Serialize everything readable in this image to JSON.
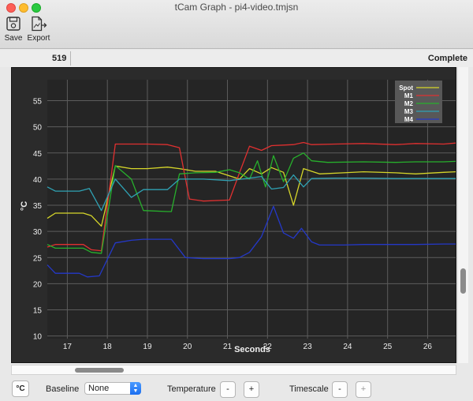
{
  "window": {
    "title": "tCam Graph - pi4-video.tmjsn"
  },
  "toolbar": {
    "save_label": "Save",
    "export_label": "Export"
  },
  "info": {
    "frame": "519",
    "status": "Complete"
  },
  "bottom": {
    "unit_button": "°C",
    "baseline_label": "Baseline",
    "baseline_value": "None",
    "temperature_label": "Temperature",
    "minus": "-",
    "plus": "+",
    "timescale_label": "Timescale"
  },
  "colors": {
    "spot": "#d6d62a",
    "m1": "#e03030",
    "m2": "#27b02c",
    "m3": "#2fa2b4",
    "m4": "#2438c8",
    "plot_bg": "#252525",
    "grid": "#5c5c5c"
  },
  "chart_data": {
    "type": "line",
    "xlabel": "Seconds",
    "ylabel": "°C",
    "xlim": [
      16.5,
      26.7
    ],
    "ylim": [
      9.5,
      59
    ],
    "xticks": [
      17,
      18,
      19,
      20,
      21,
      22,
      23,
      24,
      25,
      26
    ],
    "yticks": [
      10,
      15,
      20,
      25,
      30,
      35,
      40,
      45,
      50,
      55
    ],
    "grid": true,
    "legend_position": "top-right",
    "series": [
      {
        "name": "Spot",
        "color": "#d6d62a",
        "points": [
          [
            16.5,
            32.5
          ],
          [
            16.7,
            33.5
          ],
          [
            17.4,
            33.5
          ],
          [
            17.6,
            33
          ],
          [
            17.85,
            31
          ],
          [
            18.2,
            42.5
          ],
          [
            18.6,
            42
          ],
          [
            19,
            42
          ],
          [
            19.5,
            42.3
          ],
          [
            19.8,
            42
          ],
          [
            20.2,
            41.5
          ],
          [
            20.7,
            41.5
          ],
          [
            21.3,
            40
          ],
          [
            21.55,
            42
          ],
          [
            21.85,
            41
          ],
          [
            22.1,
            42.2
          ],
          [
            22.4,
            41.3
          ],
          [
            22.65,
            35
          ],
          [
            22.9,
            42
          ],
          [
            23.3,
            41
          ],
          [
            23.9,
            41.2
          ],
          [
            24.4,
            41.4
          ],
          [
            25.2,
            41.2
          ],
          [
            25.7,
            41
          ],
          [
            26.4,
            41.3
          ],
          [
            26.7,
            41.4
          ]
        ]
      },
      {
        "name": "M1",
        "color": "#e03030",
        "points": [
          [
            16.5,
            27
          ],
          [
            16.7,
            27.5
          ],
          [
            17.4,
            27.5
          ],
          [
            17.6,
            26.5
          ],
          [
            17.85,
            26.3
          ],
          [
            18.2,
            46.7
          ],
          [
            18.6,
            46.7
          ],
          [
            19,
            46.7
          ],
          [
            19.5,
            46.6
          ],
          [
            19.8,
            46
          ],
          [
            20.05,
            36.2
          ],
          [
            20.4,
            35.8
          ],
          [
            21.05,
            36
          ],
          [
            21.3,
            41.2
          ],
          [
            21.55,
            46.3
          ],
          [
            21.85,
            45.5
          ],
          [
            22.1,
            46.4
          ],
          [
            22.4,
            46.5
          ],
          [
            22.65,
            46.6
          ],
          [
            22.9,
            47
          ],
          [
            23.1,
            46.6
          ],
          [
            23.7,
            46.7
          ],
          [
            24.4,
            46.8
          ],
          [
            25.2,
            46.6
          ],
          [
            25.7,
            46.8
          ],
          [
            26.4,
            46.7
          ],
          [
            26.7,
            46.9
          ]
        ]
      },
      {
        "name": "M2",
        "color": "#27b02c",
        "points": [
          [
            16.5,
            27.5
          ],
          [
            16.7,
            26.8
          ],
          [
            17.4,
            26.8
          ],
          [
            17.6,
            26
          ],
          [
            17.85,
            25.8
          ],
          [
            18.2,
            42.6
          ],
          [
            18.6,
            40
          ],
          [
            18.9,
            34
          ],
          [
            19.5,
            33.8
          ],
          [
            19.6,
            33.8
          ],
          [
            19.8,
            41
          ],
          [
            20.2,
            41.2
          ],
          [
            20.7,
            41.3
          ],
          [
            21.05,
            41.8
          ],
          [
            21.3,
            41.2
          ],
          [
            21.55,
            40
          ],
          [
            21.75,
            43.5
          ],
          [
            21.95,
            38.5
          ],
          [
            22.15,
            44.5
          ],
          [
            22.4,
            39.5
          ],
          [
            22.65,
            44
          ],
          [
            22.9,
            45
          ],
          [
            23.1,
            43.5
          ],
          [
            23.5,
            43.2
          ],
          [
            24.4,
            43.3
          ],
          [
            25.2,
            43.2
          ],
          [
            25.7,
            43.3
          ],
          [
            26.4,
            43.3
          ],
          [
            26.7,
            43.4
          ]
        ]
      },
      {
        "name": "M3",
        "color": "#2fa2b4",
        "points": [
          [
            16.5,
            38.5
          ],
          [
            16.7,
            37.7
          ],
          [
            17.3,
            37.7
          ],
          [
            17.55,
            38.2
          ],
          [
            17.85,
            34
          ],
          [
            18.2,
            40
          ],
          [
            18.6,
            36.5
          ],
          [
            18.9,
            38
          ],
          [
            19.5,
            38
          ],
          [
            19.8,
            40
          ],
          [
            20.4,
            40
          ],
          [
            21.05,
            39.7
          ],
          [
            21.55,
            40.2
          ],
          [
            21.85,
            40.5
          ],
          [
            22.1,
            38.1
          ],
          [
            22.4,
            38.4
          ],
          [
            22.65,
            40.8
          ],
          [
            22.9,
            38.5
          ],
          [
            23.1,
            40.1
          ],
          [
            23.7,
            40.2
          ],
          [
            24.4,
            40.2
          ],
          [
            25.2,
            40.1
          ],
          [
            25.7,
            40.1
          ],
          [
            26.4,
            40.1
          ],
          [
            26.7,
            40.1
          ]
        ]
      },
      {
        "name": "M4",
        "color": "#2438c8",
        "points": [
          [
            16.5,
            23.6
          ],
          [
            16.7,
            22
          ],
          [
            17.3,
            22
          ],
          [
            17.5,
            21.3
          ],
          [
            17.8,
            21.5
          ],
          [
            18.2,
            27.8
          ],
          [
            18.6,
            28.3
          ],
          [
            18.9,
            28.5
          ],
          [
            19.5,
            28.5
          ],
          [
            19.6,
            28.5
          ],
          [
            19.95,
            25
          ],
          [
            20.4,
            24.8
          ],
          [
            20.9,
            24.8
          ],
          [
            21.05,
            24.8
          ],
          [
            21.3,
            25
          ],
          [
            21.55,
            26
          ],
          [
            21.85,
            29
          ],
          [
            22.15,
            34.8
          ],
          [
            22.4,
            29.7
          ],
          [
            22.65,
            28.7
          ],
          [
            22.85,
            30.6
          ],
          [
            23.1,
            28
          ],
          [
            23.3,
            27.4
          ],
          [
            23.9,
            27.4
          ],
          [
            24.4,
            27.5
          ],
          [
            25.2,
            27.5
          ],
          [
            25.7,
            27.5
          ],
          [
            26.4,
            27.6
          ],
          [
            26.7,
            27.6
          ]
        ]
      }
    ]
  }
}
